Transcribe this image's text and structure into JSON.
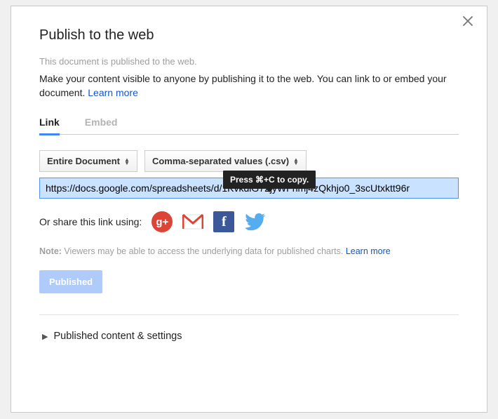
{
  "dialog": {
    "title": "Publish to the web",
    "status": "This document is published to the web.",
    "description_pre": "Make your content visible to anyone by publishing it to the web. You can link to or embed your document. ",
    "learn_more": "Learn more"
  },
  "tabs": {
    "link": "Link",
    "embed": "Embed"
  },
  "selects": {
    "scope": "Entire Document",
    "format": "Comma-separated values (.csv)"
  },
  "tooltip": "Press ⌘+C to copy.",
  "url": "https://docs.google.com/spreadsheets/d/1KvkdlG72jyWFhmj4zQkhjo0_3scUtxktt96r",
  "share": {
    "prefix": "Or share this link using:",
    "gplus": "g+",
    "gmail": "M",
    "facebook": "f",
    "twitter": "t"
  },
  "note": {
    "label": "Note:",
    "text": " Viewers may be able to access the underlying data for published charts. ",
    "learn_more": "Learn more"
  },
  "buttons": {
    "published": "Published"
  },
  "expander": {
    "label": "Published content & settings"
  }
}
